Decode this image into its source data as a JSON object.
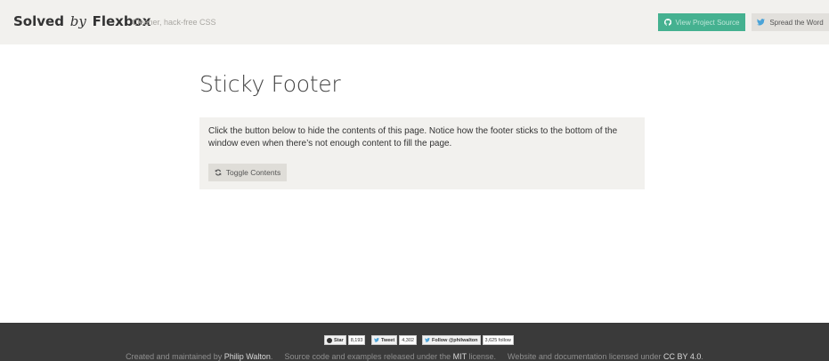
{
  "header": {
    "brand_solved": "Solved",
    "brand_by": "by",
    "brand_flexbox": "Flexbox",
    "tagline": "Cleaner, hack-free CSS",
    "source_button": "View Project Source",
    "spread_button": "Spread the Word",
    "icons": {
      "source": "github-icon",
      "spread": "twitter-icon"
    },
    "colors": {
      "background": "#f2f1ee",
      "source_button": "#45b190"
    }
  },
  "main": {
    "title": "Sticky Footer",
    "description": "Click the button below to hide the contents of this page. Notice how the footer sticks to the bottom of the window even when there’s not enough content to fill the page.",
    "toggle_button": "Toggle Contents",
    "toggle_icon": "refresh-icon"
  },
  "footer": {
    "social": {
      "star_label": "Star",
      "star_count": "8,193",
      "tweet_label": "Tweet",
      "tweet_count": "4,302",
      "follow_label": "Follow @philwalton",
      "follow_count": "3,625 follow"
    },
    "created_text": "Created and maintained by",
    "author": "Philip Walton",
    "source_text": "Source code and examples released under the",
    "mit": "MIT",
    "license_text": "license.",
    "docs_text": "Website and documentation licensed under",
    "cc": "CC BY 4.0",
    "end_period": ".",
    "colors": {
      "background": "#3a3a3a"
    }
  }
}
